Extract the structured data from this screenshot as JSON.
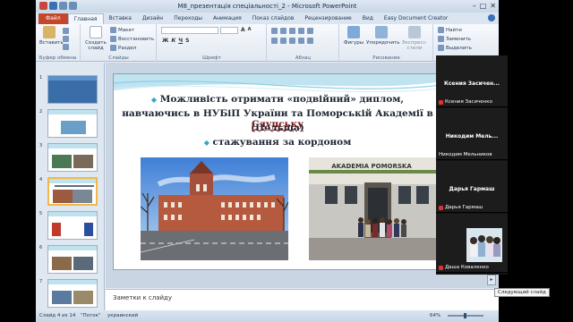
{
  "window": {
    "title": "М8_презентація спеціальності_2  -  Microsoft PowerPoint",
    "controls": [
      "–",
      "□",
      "✕"
    ]
  },
  "ribbon_tabs": {
    "file": "Файл",
    "tabs": [
      "Главная",
      "Вставка",
      "Дизайн",
      "Переходы",
      "Анимация",
      "Показ слайдов",
      "Рецензирование",
      "Вид",
      "Easy Document Creator"
    ]
  },
  "ribbon": {
    "clipboard": {
      "paste": "Вставить",
      "group": "Буфер обмена"
    },
    "slides": {
      "new_slide": "Создать слайд",
      "layout": "Макет",
      "reset": "Восстановить",
      "section": "Раздел",
      "group": "Слайды"
    },
    "font": {
      "group": "Шрифт",
      "bold": "Ж",
      "italic": "К",
      "underline": "Ч",
      "strike": "S",
      "grow": "A",
      "shrink": "A"
    },
    "paragraph": {
      "group": "Абзац"
    },
    "drawing": {
      "shapes": "Фигуры",
      "arrange": "Упорядочить",
      "styles": "Экспресс-стили",
      "group": "Рисование"
    },
    "editing": {
      "find": "Найти",
      "replace": "Заменить",
      "select": "Выделить"
    }
  },
  "thumbnails": {
    "numbers": [
      "1",
      "2",
      "3",
      "4",
      "5",
      "6",
      "7"
    ],
    "selected_index": 4
  },
  "slide": {
    "line1": "Можливість отримати «подвійний» диплом,",
    "line2a": "навчаючись в НУБіП України та Поморській Академії в ",
    "line2b": "Слупську",
    "line3": "(Польща)",
    "line4": "стажування за кордоном",
    "bullet": "◆",
    "photo2_sign": "AKADEMIA POMORSKA"
  },
  "notes": {
    "placeholder": "Заметки к слайду"
  },
  "statusbar": {
    "slide": "Слайд 4 из 14",
    "theme": "\"Поток\"",
    "language": "украинский",
    "zoom": "64%"
  },
  "participants": [
    {
      "name": "Ксения  Засичен...",
      "label": "Ксения Засиченко"
    },
    {
      "name": "Никодим  Мель...",
      "label": "Никодим Мельников"
    },
    {
      "name": "Дарья  Гармаш",
      "label": "Дарья Гармаш"
    },
    {
      "name": "",
      "label": "Даша Коваленко"
    }
  ],
  "tooltip": "Следующий слайд",
  "colors": {
    "file_tab": "#c4462b",
    "accent_bullet": "#2fa6c2",
    "selected_thumb": "#f0b84a"
  }
}
